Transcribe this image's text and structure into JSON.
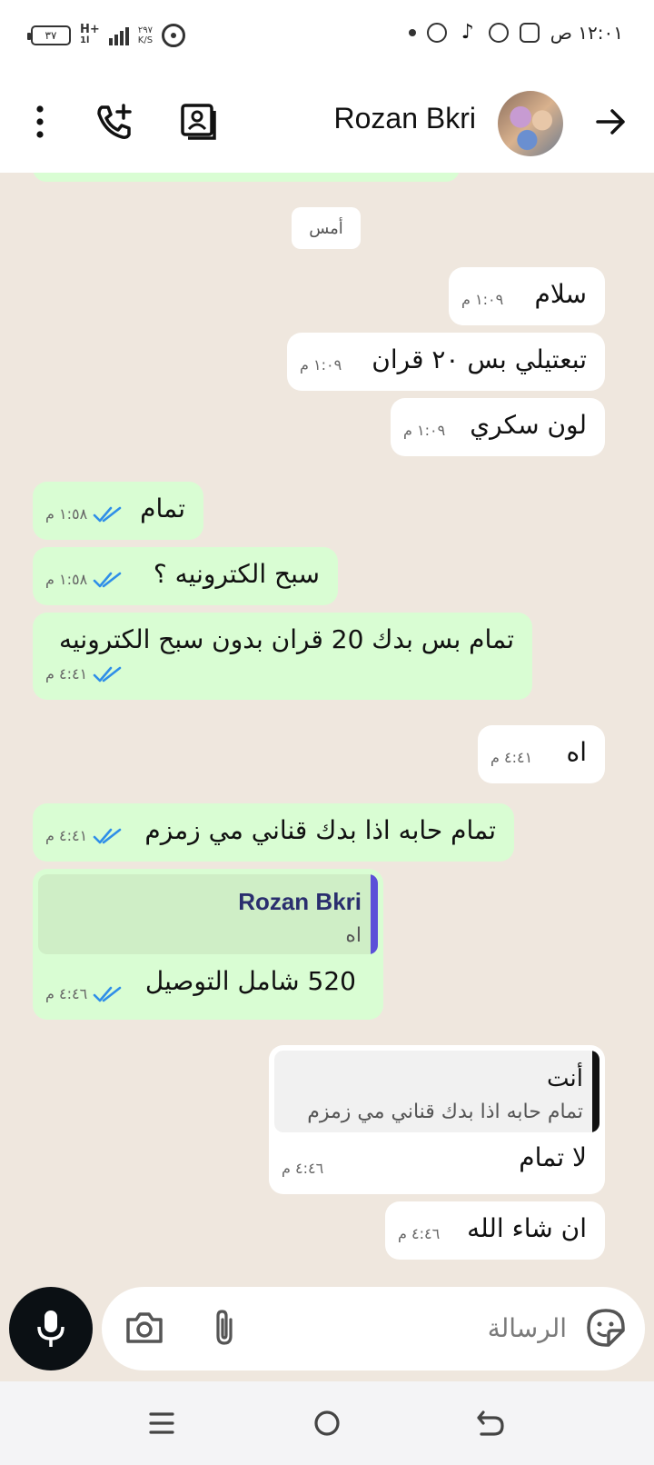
{
  "status_bar": {
    "time": "١٢:٠١ ص",
    "battery": "٣٧",
    "network": "H+",
    "network_sub": "1l",
    "speed_value": "٢٩٧",
    "speed_unit": "K/S"
  },
  "header": {
    "contact_name": "Rozan Bkri"
  },
  "chat": {
    "date_chip": "أمس",
    "messages": [
      {
        "text": "سلام",
        "time": "١:٠٩ م"
      },
      {
        "text": "تبعتيلي بس ٢٠ قران",
        "time": "١:٠٩ م"
      },
      {
        "text": "لون سكري",
        "time": "١:٠٩ م"
      },
      {
        "text": "تمام",
        "time": "١:٥٨ م"
      },
      {
        "text": "سبح الكترونيه ؟",
        "time": "١:٥٨ م"
      },
      {
        "text": "تمام بس بدك 20 قران بدون سبح الكترونيه",
        "time": "٤:٤١ م"
      },
      {
        "text": "اه",
        "time": "٤:٤١ م"
      },
      {
        "text": "تمام حابه اذا بدك قناني مي زمزم",
        "time": "٤:٤١ م"
      },
      {
        "text": "520 شامل التوصيل",
        "time": "٤:٤٦ م",
        "quote_name": "Rozan Bkri",
        "quote_text": "اه"
      },
      {
        "text": "لا تمام",
        "time": "٤:٤٦ م",
        "quote_name": "أنت",
        "quote_text": "تمام حابه اذا بدك قناني مي زمزم"
      },
      {
        "text": "ان شاء الله",
        "time": "٤:٤٦ م"
      }
    ]
  },
  "composer": {
    "placeholder": "الرسالة"
  },
  "colors": {
    "outgoing_bubble": "#d9fdd3",
    "incoming_bubble": "#ffffff",
    "chat_background": "#efe7de",
    "read_ticks": "#2f8ee8",
    "quote_bar_incoming": "#5b4fd8",
    "quote_bar_outgoing": "#111111"
  },
  "icons": [
    "back-arrow-icon",
    "avatar",
    "contact-card-icon",
    "add-call-icon",
    "more-options-icon",
    "mic-icon",
    "camera-icon",
    "attach-icon",
    "sticker-icon",
    "recents-icon",
    "home-icon",
    "back-nav-icon"
  ]
}
